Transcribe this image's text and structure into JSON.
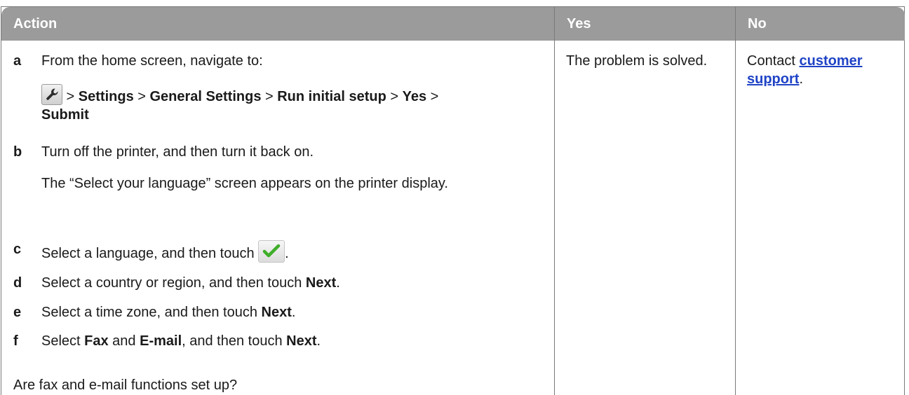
{
  "header": {
    "action": "Action",
    "yes": "Yes",
    "no": "No"
  },
  "steps": {
    "a": {
      "letter": "a",
      "text": "From the home screen, navigate to:",
      "path_sep1": " > ",
      "settings": "Settings",
      "sep2": " > ",
      "general_settings": "General Settings",
      "sep3": " > ",
      "run_initial_setup": "Run initial setup",
      "sep4": " > ",
      "yes": "Yes",
      "sep5": " >",
      "submit": "Submit",
      "icon": "wrench-icon"
    },
    "b": {
      "letter": "b",
      "text": "Turn off the printer, and then turn it back on.",
      "note": "The “Select your language” screen appears on the printer display."
    },
    "c": {
      "letter": "c",
      "text": "Select a language, and then touch ",
      "end": ".",
      "icon": "checkmark-icon"
    },
    "d": {
      "letter": "d",
      "text": "Select a country or region, and then touch ",
      "bold": "Next",
      "end": "."
    },
    "e": {
      "letter": "e",
      "text": "Select a time zone, and then touch ",
      "bold": "Next",
      "end": "."
    },
    "f": {
      "letter": "f",
      "pre": "Select ",
      "fax": "Fax",
      "and": " and ",
      "email": "E-mail",
      "mid": ", and then touch ",
      "next": "Next",
      "end": "."
    }
  },
  "question": "Are fax and e-mail functions set up?",
  "yes_cell": "The problem is solved.",
  "no_cell": {
    "prefix": "Contact ",
    "link": "customer support",
    "suffix": "."
  },
  "colors": {
    "header_bg": "#9b9b9b",
    "link": "#1f43c6",
    "checkmark": "#3fae2a"
  }
}
